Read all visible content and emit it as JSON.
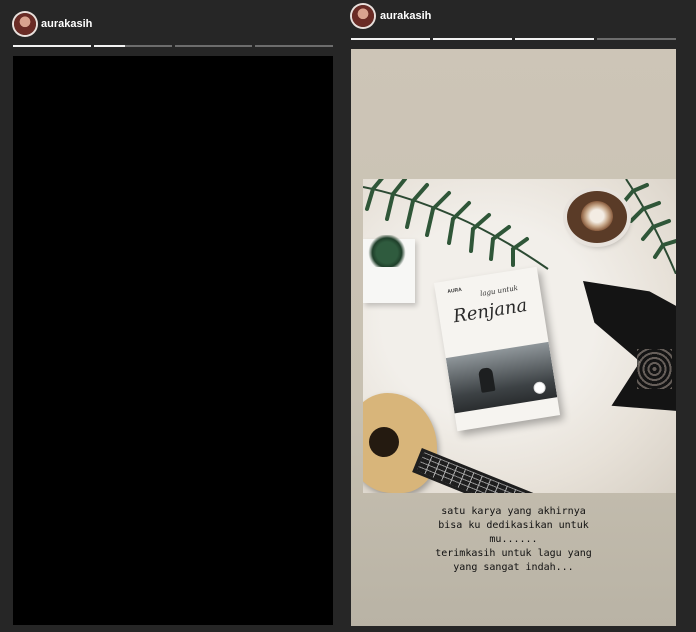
{
  "stories": [
    {
      "username": "aurakasih",
      "progress": [
        1,
        0.4,
        0,
        0
      ]
    },
    {
      "username": "aurakasih",
      "progress": [
        1,
        1,
        1,
        0
      ]
    }
  ],
  "book": {
    "author": "AURA",
    "subtitle": "lagu untuk",
    "title": "Renjana"
  },
  "caption_lines": [
    "satu karya yang akhirnya",
    "bisa ku dedikasikan untuk",
    "mu......",
    "terimkasih untuk lagu yang",
    "yang sangat indah..."
  ],
  "colors": {
    "background": "#262626",
    "progress_track": "#6d6d6d",
    "progress_fill": "#f2f2f2",
    "story_right_bg": "#c8c1b2"
  }
}
